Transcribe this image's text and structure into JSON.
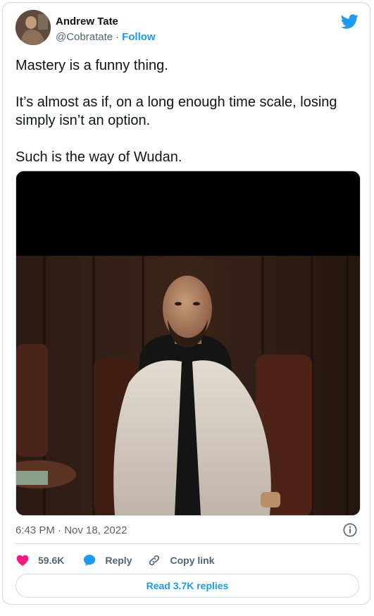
{
  "author": {
    "name": "Andrew Tate",
    "handle": "@Cobratate",
    "separator": "·",
    "follow_label": "Follow"
  },
  "tweet": {
    "paragraphs": [
      "Mastery is a funny thing.",
      "It’s almost as if, on a long enough time scale, losing simply isn’t an option.",
      "Such is the way of Wudan."
    ],
    "timestamp": "6:43 PM · Nov 18, 2022"
  },
  "icons": {
    "brand": "twitter-bird-icon",
    "info": "info-icon",
    "like": "heart-icon",
    "reply": "speech-bubble-icon",
    "copy": "link-icon"
  },
  "actions": {
    "likes": "59.6K",
    "reply_label": "Reply",
    "copy_label": "Copy link"
  },
  "read_replies_label": "Read 3.7K replies",
  "colors": {
    "accent": "#1d9bf0",
    "like": "#f91880",
    "text": "#0f1419",
    "muted": "#536471",
    "border": "#cfd9de"
  }
}
